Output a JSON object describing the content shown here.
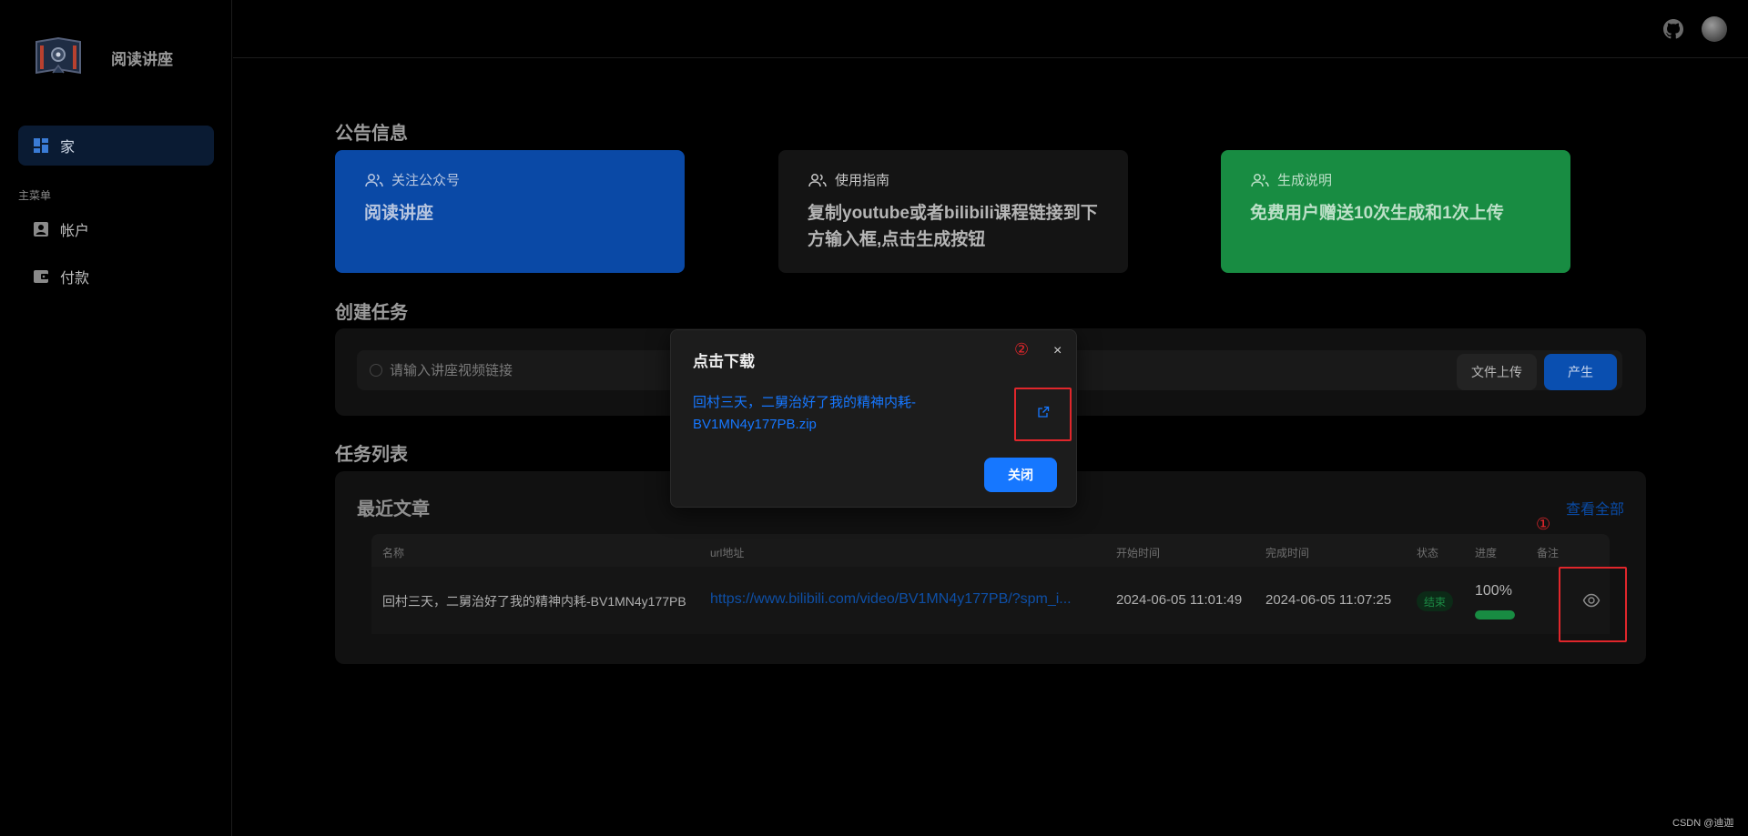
{
  "sidebar": {
    "brand_name": "阅读讲座",
    "home_label": "家",
    "submenu_title": "主菜单",
    "items": [
      {
        "label": "帐户",
        "icon": "account-icon"
      },
      {
        "label": "付款",
        "icon": "wallet-icon"
      }
    ]
  },
  "header": {
    "github_icon": "github-icon",
    "avatar": "user-avatar"
  },
  "announcement": {
    "title": "公告信息",
    "cards": [
      {
        "head": "关注公众号",
        "body": "阅读讲座",
        "color": "#0a49a6"
      },
      {
        "head": "使用指南",
        "body": "复制youtube或者bilibili课程链接到下方输入框,点击生成按钮",
        "color": "#141414"
      },
      {
        "head": "生成说明",
        "body": "免费用户赠送10次生成和1次上传",
        "color": "#188c42"
      }
    ]
  },
  "create": {
    "title": "创建任务",
    "input_placeholder": "请输入讲座视频链接",
    "input_value": "",
    "upload_label": "文件上传",
    "generate_label": "产生"
  },
  "tasks": {
    "title": "任务列表",
    "recent_title": "最近文章",
    "view_all": "查看全部",
    "columns": [
      "名称",
      "url地址",
      "开始时间",
      "完成时间",
      "状态",
      "进度",
      "备注"
    ],
    "rows": [
      {
        "name": "回村三天，二舅治好了我的精神内耗-BV1MN4y177PB",
        "url": "https://www.bilibili.com/video/BV1MN4y177PB/?spm_i...",
        "start": "2024-06-05 11:01:49",
        "end": "2024-06-05 11:07:25",
        "status": "结束",
        "progress_text": "100%",
        "progress": 1.0
      }
    ]
  },
  "modal": {
    "title": "点击下载",
    "close_symbol": "×",
    "link_text": "回村三天，二舅治好了我的精神内耗-BV1MN4y177PB.zip",
    "ok_label": "关闭"
  },
  "annotations": {
    "marker_1": "①",
    "marker_2": "②",
    "color": "#e0262b"
  },
  "footer_credit": "CSDN @迪迦"
}
